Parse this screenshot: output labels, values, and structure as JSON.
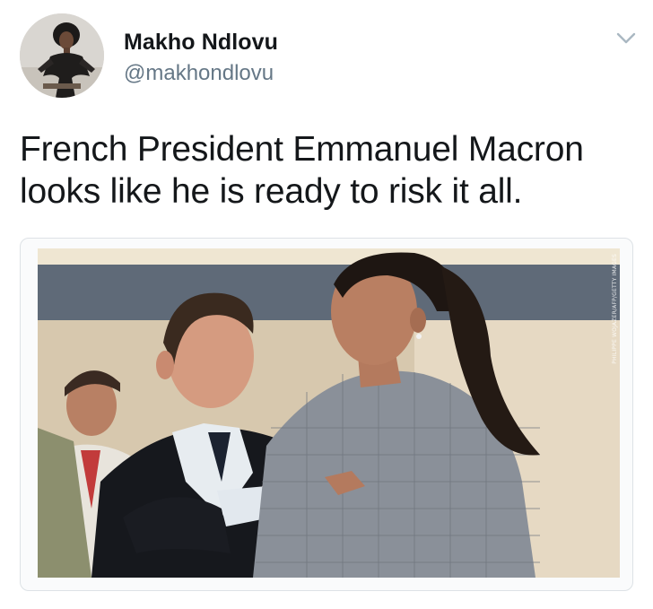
{
  "author": {
    "name": "Makho Ndlovu",
    "handle": "@makhondlovu",
    "avatar_icon": "profile-photo"
  },
  "menu": {
    "icon": "chevron-down-icon",
    "color": "#aab8c2"
  },
  "tweet": {
    "text_lines": [
      "French President Emmanuel Macron",
      "looks like he is ready to risk it all."
    ]
  },
  "media": {
    "credit": "PHILIPPE WOJAZER/AFP/GETTY IMAGES",
    "border_color": "#dde2e6"
  },
  "colors": {
    "name": "#14171a",
    "handle": "#657786",
    "text": "#14171a",
    "background": "#ffffff"
  }
}
